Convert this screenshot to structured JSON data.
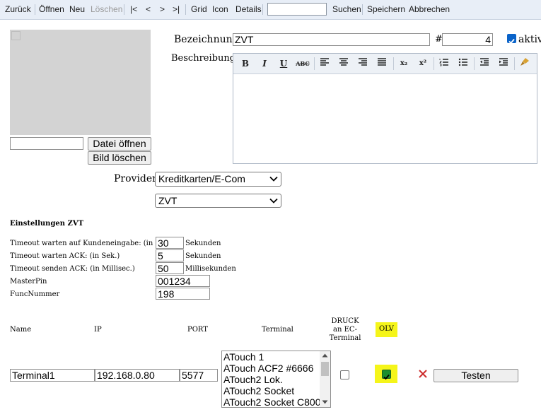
{
  "toolbar": {
    "back": "Zurück",
    "open": "Öffnen",
    "new": "Neu",
    "delete": "Löschen",
    "first": "|<",
    "prev": "<",
    "next": ">",
    "last": ">|",
    "grid": "Grid",
    "icon": "Icon",
    "details": "Details",
    "search_value": "",
    "search": "Suchen",
    "save": "Speichern",
    "cancel": "Abbrechen"
  },
  "image": {
    "file_value": "",
    "open_file": "Datei öffnen",
    "delete_image": "Bild löschen"
  },
  "form": {
    "bezeichnung_label": "Bezeichnung",
    "bezeichnung_value": "ZVT",
    "hash_label": "#",
    "number_value": "4",
    "aktiv_label": "aktiv",
    "aktiv_checked": true,
    "beschreibung_label": "Beschreibung",
    "beschreibung_value": "",
    "provider_label": "Provider",
    "provider_value": "Kreditkarten/E-Com",
    "provider_type_value": "ZVT"
  },
  "editor_tools": {
    "bold": "B",
    "italic": "I",
    "underline": "U",
    "strike": "ABC",
    "subscript": "x₂",
    "superscript": "x²"
  },
  "settings": {
    "title": "Einstellungen ZVT",
    "rows": [
      {
        "label": "Timeout warten auf Kundeneingabe: (in Sek.)",
        "value": "30",
        "unit": "Sekunden"
      },
      {
        "label": "Timeout warten ACK: (in Sek.)",
        "value": "5",
        "unit": "Sekunden"
      },
      {
        "label": "Timeout senden ACK: (in Millisec.)",
        "value": "50",
        "unit": "Millisekunden"
      },
      {
        "label": "MasterPin",
        "value": "001234",
        "unit": ""
      },
      {
        "label": "FuncNummer",
        "value": "198",
        "unit": ""
      }
    ]
  },
  "terminal_table": {
    "headers": {
      "name": "Name",
      "ip": "IP",
      "port": "PORT",
      "terminal": "Terminal",
      "druck": "DRUCK an EC-Terminal",
      "olv": "OLV"
    },
    "row": {
      "name": "Terminal1",
      "ip": "192.168.0.80",
      "port": "5577",
      "terminal_options": [
        "ATouch 1",
        "ATouch ACF2 #6666",
        "ATouch2 Lok.",
        "ATouch2 Socket",
        "ATouch2 Socket C800"
      ],
      "druck_checked": false,
      "olv_checked": true,
      "test_button": "Testen"
    }
  },
  "colors": {
    "highlight": "#f5f51a",
    "delete_x": "#cc2b2b",
    "checkbox_on": "#0a63c9",
    "toolbar_bg": "#e8eef7"
  },
  "icons": {
    "delete": "close-x-icon",
    "editor_clean": "brush-icon"
  }
}
